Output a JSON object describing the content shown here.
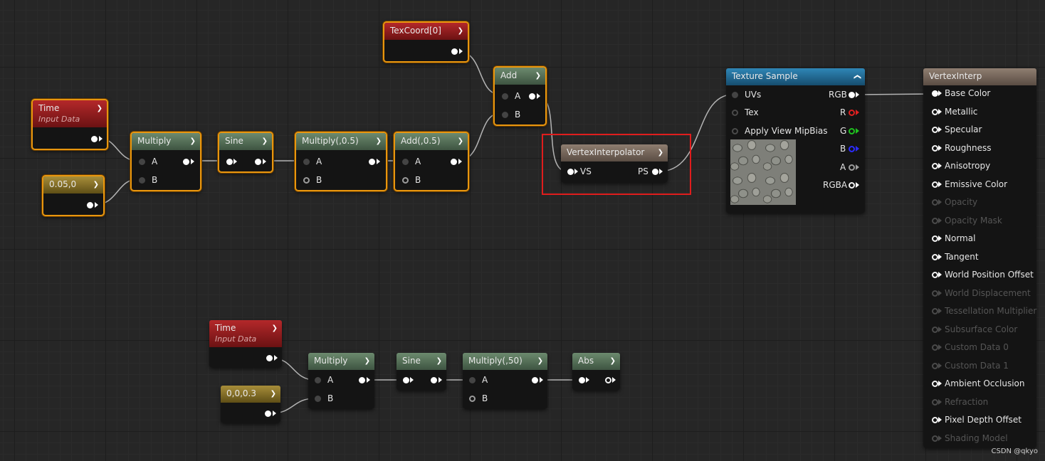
{
  "nodes": {
    "time_top": {
      "title": "Time",
      "subtitle": "Input Data"
    },
    "const_top": {
      "title": "0.05,0"
    },
    "multiply_top": {
      "title": "Multiply",
      "pin_a": "A",
      "pin_b": "B"
    },
    "sine_top": {
      "title": "Sine"
    },
    "multiply05": {
      "title": "Multiply(,0.5)",
      "pin_a": "A",
      "pin_b": "B"
    },
    "add05": {
      "title": "Add(,0.5)",
      "pin_a": "A",
      "pin_b": "B"
    },
    "texcoord": {
      "title": "TexCoord[0]"
    },
    "add": {
      "title": "Add",
      "pin_a": "A",
      "pin_b": "B"
    },
    "vertex_interpolator": {
      "title": "VertexInterpolator",
      "pin_in": "VS",
      "pin_out": "PS"
    },
    "texture_sample": {
      "title": "Texture Sample",
      "inputs": [
        "UVs",
        "Tex",
        "Apply View MipBias"
      ],
      "outputs": [
        "RGB",
        "R",
        "G",
        "B",
        "A",
        "RGBA"
      ]
    },
    "time_bottom": {
      "title": "Time",
      "subtitle": "Input Data"
    },
    "const_bottom": {
      "title": "0,0,0.3"
    },
    "multiply_bottom": {
      "title": "Multiply",
      "pin_a": "A",
      "pin_b": "B"
    },
    "sine_bottom": {
      "title": "Sine"
    },
    "multiply50": {
      "title": "Multiply(,50)",
      "pin_a": "A",
      "pin_b": "B"
    },
    "abs": {
      "title": "Abs"
    }
  },
  "material": {
    "title": "VertexInterp",
    "pins": [
      {
        "label": "Base Color",
        "state": "connected"
      },
      {
        "label": "Metallic",
        "state": "enabled"
      },
      {
        "label": "Specular",
        "state": "enabled"
      },
      {
        "label": "Roughness",
        "state": "enabled"
      },
      {
        "label": "Anisotropy",
        "state": "enabled"
      },
      {
        "label": "Emissive Color",
        "state": "enabled"
      },
      {
        "label": "Opacity",
        "state": "disabled"
      },
      {
        "label": "Opacity Mask",
        "state": "disabled"
      },
      {
        "label": "Normal",
        "state": "enabled"
      },
      {
        "label": "Tangent",
        "state": "enabled"
      },
      {
        "label": "World Position Offset",
        "state": "enabled"
      },
      {
        "label": "World Displacement",
        "state": "disabled"
      },
      {
        "label": "Tessellation Multiplier",
        "state": "disabled"
      },
      {
        "label": "Subsurface Color",
        "state": "disabled"
      },
      {
        "label": "Custom Data 0",
        "state": "disabled"
      },
      {
        "label": "Custom Data 1",
        "state": "disabled"
      },
      {
        "label": "Ambient Occlusion",
        "state": "enabled"
      },
      {
        "label": "Refraction",
        "state": "disabled"
      },
      {
        "label": "Pixel Depth Offset",
        "state": "enabled"
      },
      {
        "label": "Shading Model",
        "state": "disabled"
      }
    ]
  },
  "colors": {
    "selection": "#e8960f",
    "highlight_box": "#e01d1d",
    "pin_red": "#e02020",
    "pin_green": "#1fc21f",
    "pin_blue": "#2b2bff"
  },
  "watermark": "CSDN @qkyo"
}
